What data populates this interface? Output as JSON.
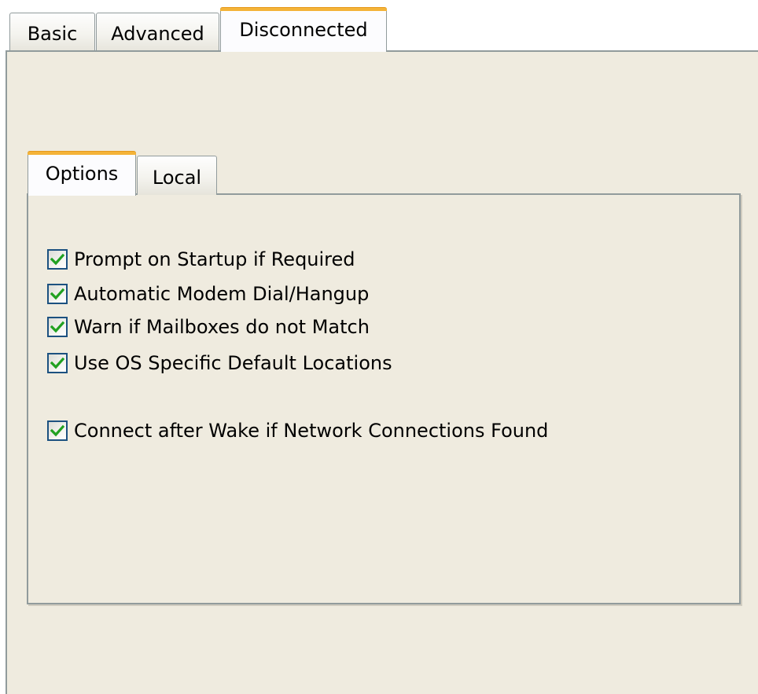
{
  "outer_tabs": [
    {
      "label": "Basic",
      "selected": false
    },
    {
      "label": "Advanced",
      "selected": false
    },
    {
      "label": "Disconnected",
      "selected": true
    }
  ],
  "inner_tabs": [
    {
      "label": "Options",
      "selected": true
    },
    {
      "label": "Local",
      "selected": false
    }
  ],
  "options": [
    {
      "label": "Prompt on Startup if Required",
      "checked": true
    },
    {
      "label": "Automatic Modem Dial/Hangup",
      "checked": true
    },
    {
      "label": "Warn if Mailboxes do not Match",
      "checked": true
    },
    {
      "label": "Use OS Specific Default Locations",
      "checked": true
    },
    {
      "label": "Connect after Wake if Network Connections Found",
      "checked": true
    }
  ],
  "colors": {
    "panel_background": "#efebdf",
    "selected_tab_accent": "#f4b338",
    "border": "#919b9c",
    "checkbox_border": "#1c5180",
    "checkmark": "#21a121"
  },
  "icons": {
    "checkmark": "checkmark-icon"
  }
}
